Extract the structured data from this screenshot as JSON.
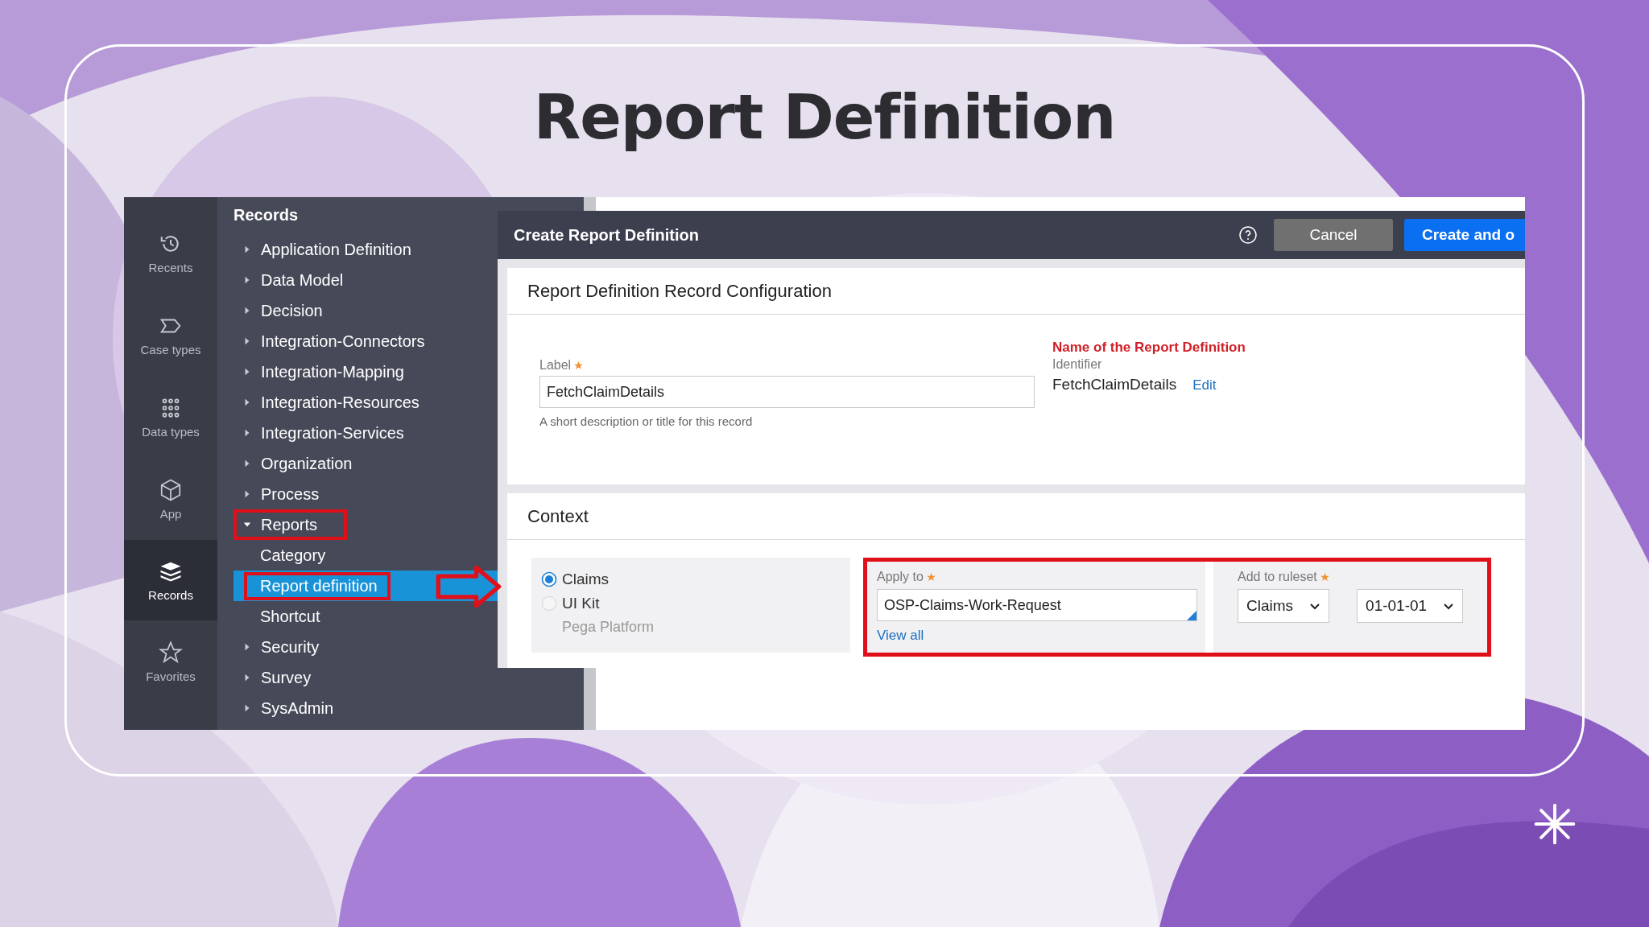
{
  "slide": {
    "title": "Report Definition"
  },
  "rail": [
    {
      "label": "Recents",
      "selected": false
    },
    {
      "label": "Case types",
      "selected": false
    },
    {
      "label": "Data types",
      "selected": false
    },
    {
      "label": "App",
      "selected": false
    },
    {
      "label": "Records",
      "selected": true
    },
    {
      "label": "Favorites",
      "selected": false
    }
  ],
  "nav": {
    "title": "Records",
    "items": [
      {
        "label": "Application Definition",
        "expanded": false,
        "highlighted": false
      },
      {
        "label": "Data Model",
        "expanded": false,
        "highlighted": false
      },
      {
        "label": "Decision",
        "expanded": false,
        "highlighted": false
      },
      {
        "label": "Integration-Connectors",
        "expanded": false,
        "highlighted": false
      },
      {
        "label": "Integration-Mapping",
        "expanded": false,
        "highlighted": false
      },
      {
        "label": "Integration-Resources",
        "expanded": false,
        "highlighted": false
      },
      {
        "label": "Integration-Services",
        "expanded": false,
        "highlighted": false
      },
      {
        "label": "Organization",
        "expanded": false,
        "highlighted": false
      },
      {
        "label": "Process",
        "expanded": false,
        "highlighted": false
      },
      {
        "label": "Reports",
        "expanded": true,
        "highlighted": true,
        "children": [
          {
            "label": "Category",
            "selected": false,
            "highlighted": false
          },
          {
            "label": "Report definition",
            "selected": true,
            "highlighted": true
          },
          {
            "label": "Shortcut",
            "selected": false,
            "highlighted": false
          }
        ]
      },
      {
        "label": "Security",
        "expanded": false,
        "highlighted": false
      },
      {
        "label": "Survey",
        "expanded": false,
        "highlighted": false
      },
      {
        "label": "SysAdmin",
        "expanded": false,
        "highlighted": false
      }
    ]
  },
  "pointer_arrow": true,
  "dialog": {
    "title": "Create Report Definition",
    "buttons": [
      {
        "label": "Cancel",
        "kind": "secondary"
      },
      {
        "label": "Create and o",
        "kind": "primary"
      }
    ],
    "configuration": {
      "heading": "Report Definition Record Configuration",
      "label_field": {
        "label": "Label",
        "required": true,
        "value": "FetchClaimDetails",
        "helper": "A short description or title for this record"
      },
      "annotation": "Name of the Report Definition",
      "identifier": {
        "label": "Identifier",
        "value": "FetchClaimDetails",
        "action": "Edit"
      }
    },
    "context": {
      "heading": "Context",
      "options": [
        {
          "label": "Claims",
          "selected": true
        },
        {
          "label": "UI Kit",
          "selected": false
        }
      ],
      "platform": "Pega Platform",
      "highlighted": true,
      "apply_to": {
        "label": "Apply to",
        "required": true,
        "value": "OSP-Claims-Work-Request",
        "link": "View all"
      },
      "ruleset": {
        "label": "Add to ruleset",
        "required": true,
        "values": [
          "Claims",
          "01-01-01"
        ]
      }
    }
  }
}
